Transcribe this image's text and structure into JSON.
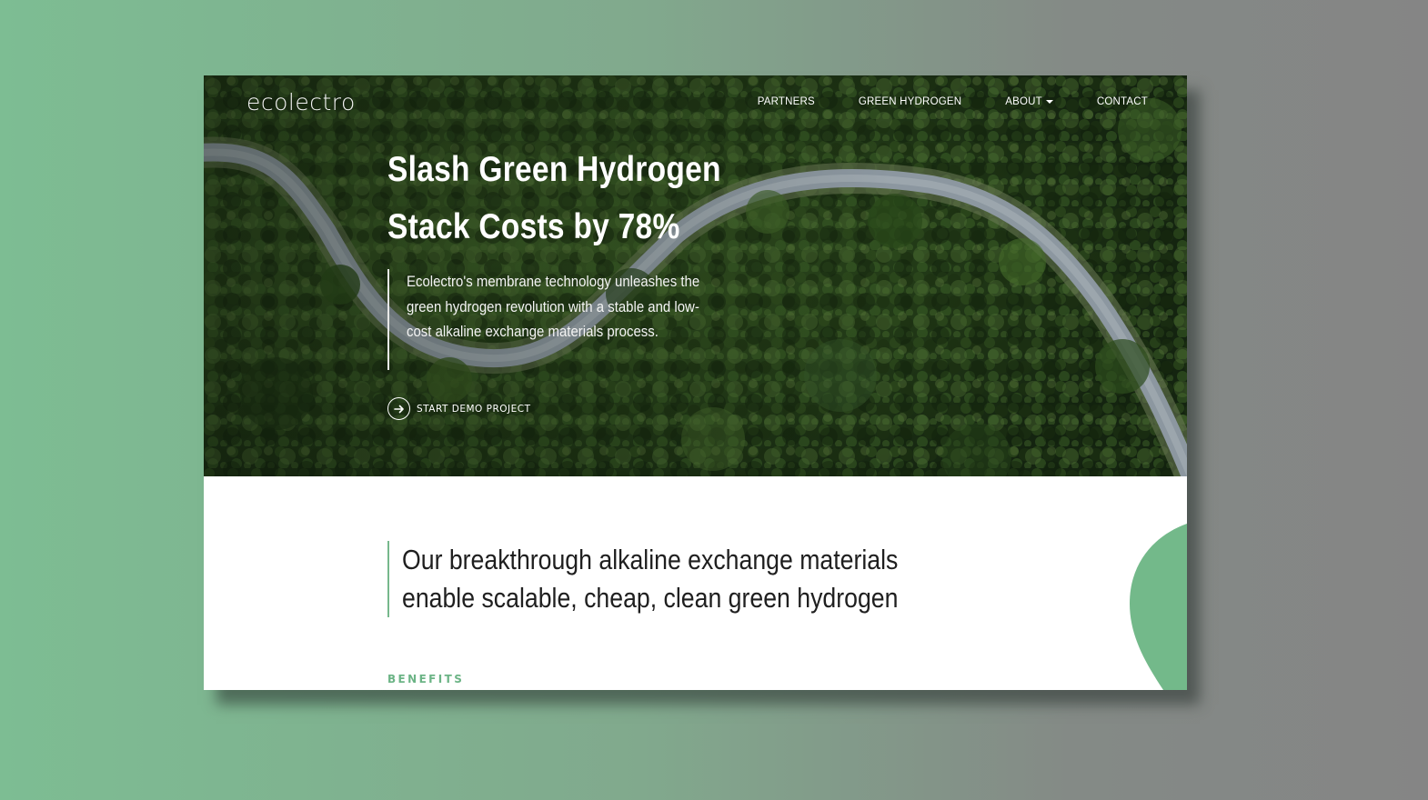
{
  "brand": {
    "logo": "ecolectro"
  },
  "nav": {
    "items": [
      {
        "label": "PARTNERS"
      },
      {
        "label": "GREEN HYDROGEN"
      },
      {
        "label": "ABOUT",
        "has_dropdown": true
      },
      {
        "label": "CONTACT"
      }
    ]
  },
  "hero": {
    "headline_line1": "Slash Green Hydrogen",
    "headline_line2": "Stack Costs by 78%",
    "intro": "Ecolectro's membrane technology unleashes the green hydrogen revolution with a stable and low-cost alkaline exchange materials process.",
    "cta_label": "START DEMO PROJECT",
    "cta_icon": "arrow-right-icon"
  },
  "statement": {
    "line1": "Our breakthrough alkaline exchange materials",
    "line2": "enable scalable, cheap, clean green hydrogen"
  },
  "benefits": {
    "label": "BENEFITS"
  },
  "colors": {
    "accent_green": "#6cb486",
    "blob_green": "#73b98a",
    "hero_text": "#ffffff",
    "body_text": "#1f1f1f"
  }
}
